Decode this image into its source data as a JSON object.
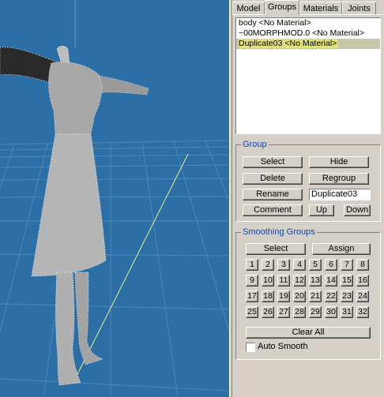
{
  "tabs": [
    {
      "label": "Model"
    },
    {
      "label": "Groups"
    },
    {
      "label": "Materials"
    },
    {
      "label": "Joints"
    }
  ],
  "groups_list": [
    {
      "label": "body <No Material>"
    },
    {
      "label": "~00MORPHMOD.0 <No Material>"
    },
    {
      "label": "Duplicate03 <No Material>"
    }
  ],
  "group_box": {
    "title": "Group",
    "select": "Select",
    "hide": "Hide",
    "delete": "Delete",
    "regroup": "Regroup",
    "rename": "Rename",
    "name_value": "Duplicate03",
    "comment": "Comment",
    "up": "Up",
    "down": "Down"
  },
  "smoothing": {
    "title": "Smoothing Groups",
    "select": "Select",
    "assign": "Assign",
    "numbers": [
      "1",
      "2",
      "3",
      "4",
      "5",
      "6",
      "7",
      "8",
      "9",
      "10",
      "11",
      "12",
      "13",
      "14",
      "15",
      "16",
      "17",
      "18",
      "19",
      "20",
      "21",
      "22",
      "23",
      "24",
      "25",
      "26",
      "27",
      "28",
      "29",
      "30",
      "31",
      "32"
    ],
    "clear_all": "Clear All",
    "auto_smooth": "Auto Smooth",
    "auto_smooth_checked": false
  },
  "colors": {
    "viewport_bg": "#2b6fa6",
    "group_title": "#1a46a0",
    "selection_highlight": "#dfe07a"
  }
}
